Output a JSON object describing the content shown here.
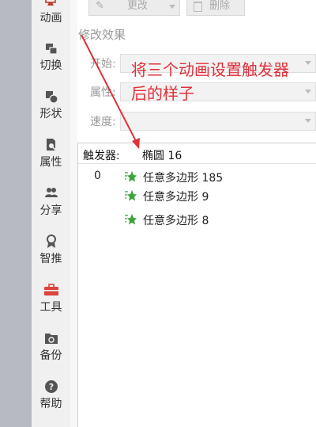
{
  "sidebar": {
    "items": [
      {
        "label": "动画",
        "icon": "animation-icon"
      },
      {
        "label": "切换",
        "icon": "transition-icon"
      },
      {
        "label": "形状",
        "icon": "shape-icon"
      },
      {
        "label": "属性",
        "icon": "property-icon"
      },
      {
        "label": "分享",
        "icon": "share-icon"
      },
      {
        "label": "智推",
        "icon": "recommend-icon"
      },
      {
        "label": "工具",
        "icon": "toolbox-icon"
      },
      {
        "label": "备份",
        "icon": "backup-icon"
      },
      {
        "label": "帮助",
        "icon": "help-icon"
      }
    ]
  },
  "toolbar": {
    "change_label": "更改",
    "delete_label": "删除"
  },
  "modify": {
    "title": "修改效果",
    "start_label": "开始:",
    "property_label": "属性:",
    "speed_label": "速度:"
  },
  "trigger": {
    "label": "触发器:",
    "value": "椭圆 16",
    "group_index": "0",
    "items": [
      "任意多边形 185",
      "任意多边形 9",
      "任意多边形 8"
    ]
  },
  "annotation": {
    "line1": "将三个动画设置触发器",
    "line2": "后的样子"
  },
  "colors": {
    "accent_green": "#3aa53a",
    "annotation_red": "#e0303a",
    "toolbox_red": "#d9463e"
  }
}
